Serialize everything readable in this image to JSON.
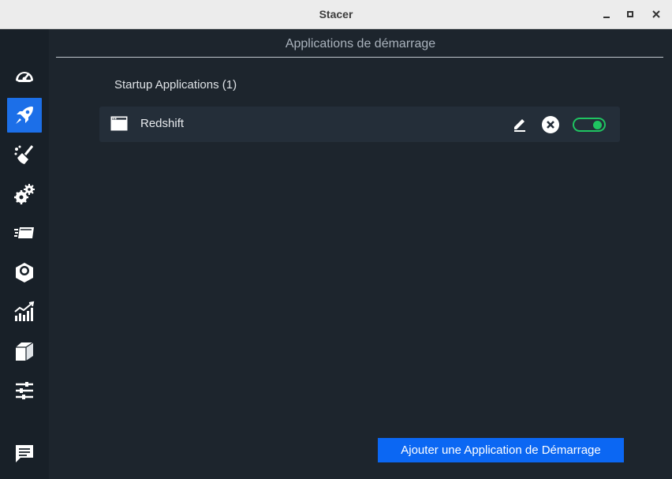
{
  "window": {
    "title": "Stacer",
    "controls": [
      "minimize-icon",
      "maximize-icon",
      "close-icon"
    ]
  },
  "sidebar": {
    "items": [
      {
        "id": "dashboard",
        "icon": "speedometer-icon",
        "active": false
      },
      {
        "id": "startup-apps",
        "icon": "rocket-icon",
        "active": true
      },
      {
        "id": "system-cleaner",
        "icon": "broom-icon",
        "active": false
      },
      {
        "id": "services",
        "icon": "gears-icon",
        "active": false
      },
      {
        "id": "processes",
        "icon": "processes-icon",
        "active": false
      },
      {
        "id": "uninstaller",
        "icon": "package-remove-icon",
        "active": false
      },
      {
        "id": "resources",
        "icon": "chart-icon",
        "active": false
      },
      {
        "id": "apt-repository",
        "icon": "box-icon",
        "active": false
      },
      {
        "id": "settings",
        "icon": "sliders-icon",
        "active": false
      },
      {
        "id": "feedback",
        "icon": "message-icon",
        "active": false
      }
    ],
    "accent": "#1c6fe8"
  },
  "main": {
    "page_title": "Applications de démarrage",
    "section_title": "Startup Applications (1)",
    "apps": [
      {
        "name": "Redshift",
        "icon": "window-icon",
        "enabled": true
      }
    ],
    "add_button_label": "Ajouter une Application de Démarrage"
  },
  "colors": {
    "background": "#1d252d",
    "row": "#242e39",
    "toggle_on": "#1fc461",
    "button": "#0b67f3"
  }
}
